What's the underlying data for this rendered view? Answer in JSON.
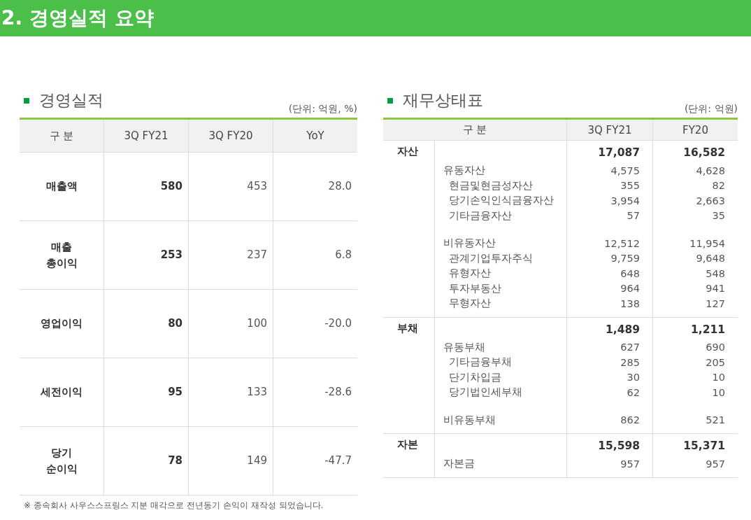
{
  "header": {
    "title": "2. 경영실적 요약"
  },
  "performance": {
    "title": "경영실적",
    "unit": "(단위: 억원, %)",
    "columns": [
      "구 분",
      "3Q FY21",
      "3Q FY20",
      "YoY"
    ],
    "rows": [
      {
        "label": "매출액",
        "cells": [
          "580",
          "453",
          "28.0"
        ]
      },
      {
        "label": "매출\n총이익",
        "cells": [
          "253",
          "237",
          "6.8"
        ]
      },
      {
        "label": "영업이익",
        "cells": [
          "80",
          "100",
          "-20.0"
        ]
      },
      {
        "label": "세전이익",
        "cells": [
          "95",
          "133",
          "-28.6"
        ]
      },
      {
        "label": "당기\n순이익",
        "cells": [
          "78",
          "149",
          "-47.7"
        ]
      }
    ],
    "footnote": "※ 종속회사 사우스스프링스 지분 매각으로 전년동기 손익이 재작성 되었습니다."
  },
  "balance": {
    "title": "재무상태표",
    "unit": "(단위: 억원)",
    "columns": [
      "구 분",
      "3Q FY21",
      "FY20"
    ],
    "sections": [
      {
        "label": "자산",
        "cells": [
          "17,087",
          "16,582"
        ],
        "items": [
          {
            "label": "유동자산",
            "cells": [
              "4,575",
              "4,628"
            ],
            "children": [
              {
                "label": "현금및현금성자산",
                "cells": [
                  "355",
                  "82"
                ]
              },
              {
                "label": "당기손익인식금융자산",
                "cells": [
                  "3,954",
                  "2,663"
                ]
              },
              {
                "label": "기타금융자산",
                "cells": [
                  "57",
                  "35"
                ]
              }
            ]
          },
          {
            "label": "비유동자산",
            "cells": [
              "12,512",
              "11,954"
            ],
            "children": [
              {
                "label": "관계기업투자주식",
                "cells": [
                  "9,759",
                  "9,648"
                ]
              },
              {
                "label": "유형자산",
                "cells": [
                  "648",
                  "548"
                ]
              },
              {
                "label": "투자부동산",
                "cells": [
                  "964",
                  "941"
                ]
              },
              {
                "label": "무형자산",
                "cells": [
                  "138",
                  "127"
                ]
              }
            ]
          }
        ]
      },
      {
        "label": "부채",
        "cells": [
          "1,489",
          "1,211"
        ],
        "items": [
          {
            "label": "유동부채",
            "cells": [
              "627",
              "690"
            ],
            "children": [
              {
                "label": "기타금융부채",
                "cells": [
                  "285",
                  "205"
                ]
              },
              {
                "label": "단기차입금",
                "cells": [
                  "30",
                  "10"
                ]
              },
              {
                "label": "당기법인세부채",
                "cells": [
                  "62",
                  "10"
                ]
              }
            ]
          },
          {
            "label": "비유동부채",
            "cells": [
              "862",
              "521"
            ]
          }
        ]
      },
      {
        "label": "자본",
        "cells": [
          "15,598",
          "15,371"
        ],
        "items": [
          {
            "label": "자본금",
            "cells": [
              "957",
              "957"
            ]
          }
        ]
      }
    ]
  }
}
